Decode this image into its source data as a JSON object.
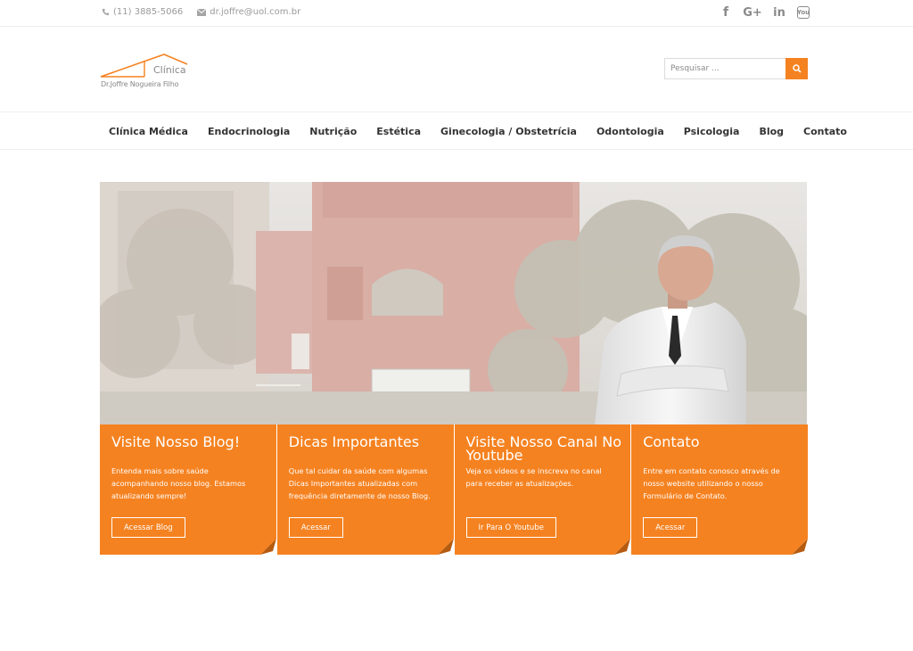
{
  "topbar": {
    "phone": "(11) 3885-5066",
    "email": "dr.joffre@uol.com.br",
    "social": [
      {
        "icon": "facebook-icon",
        "glyph": "f"
      },
      {
        "icon": "google-plus-icon",
        "glyph": "G+"
      },
      {
        "icon": "linkedin-icon",
        "glyph": "in"
      },
      {
        "icon": "youtube-icon",
        "glyph": "You"
      }
    ]
  },
  "header": {
    "logo_line1": "Clínica",
    "logo_line2": "Dr.Joffre Nogueira Filho",
    "search_placeholder": "Pesquisar ..."
  },
  "nav": {
    "items": [
      "Clínica Médica",
      "Endocrinologia",
      "Nutrição",
      "Estética",
      "Ginecologia / Obstetrícia",
      "Odontologia",
      "Psicologia",
      "Blog",
      "Contato"
    ]
  },
  "cards": [
    {
      "title": "Visite Nosso Blog!",
      "text": "Entenda mais sobre saúde acompanhando nosso blog. Estamos atualizando sempre!",
      "button": "Acessar Blog"
    },
    {
      "title": "Dicas Importantes",
      "text": "Que tal cuidar da saúde com algumas Dicas Importantes atualizadas com frequência diretamente de nosso Blog.",
      "button": "Acessar"
    },
    {
      "title": "Visite Nosso Canal No Youtube",
      "text": "Veja os vídeos e se inscreva no canal para receber as atualizações.",
      "button": "Ir Para O Youtube"
    },
    {
      "title": "Contato",
      "text": "Entre em contato conosco através de nosso website utilizando o nosso Formulário de Contato.",
      "button": "Acessar"
    }
  ],
  "colors": {
    "accent": "#f58220",
    "text": "#333333",
    "muted": "#9a9a9a"
  }
}
